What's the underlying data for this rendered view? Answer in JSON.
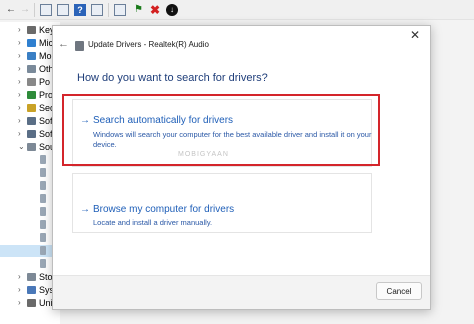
{
  "background_window": {
    "tree_labels": [
      "Key",
      "Mic",
      "Mo",
      "Oth",
      "Po",
      "Pro",
      "Sec",
      "Sof",
      "Sof",
      "Sou",
      "Sto",
      "Sys",
      "Uni"
    ]
  },
  "dialog": {
    "title": "Update Drivers - Realtek(R) Audio",
    "close_glyph": "✕",
    "back_glyph": "←",
    "heading": "How do you want to search for drivers?",
    "options": [
      {
        "arrow": "→",
        "title": "Search automatically for drivers",
        "description": "Windows will search your computer for the best available driver and install it on your device."
      },
      {
        "arrow": "→",
        "title": "Browse my computer for drivers",
        "description": "Locate and install a driver manually."
      }
    ],
    "cancel_label": "Cancel"
  },
  "watermark": "MOBIGYAAN",
  "colors": {
    "highlight": "#d4252b",
    "link_blue": "#1f5fb8",
    "heading_blue": "#1f3e7a"
  }
}
